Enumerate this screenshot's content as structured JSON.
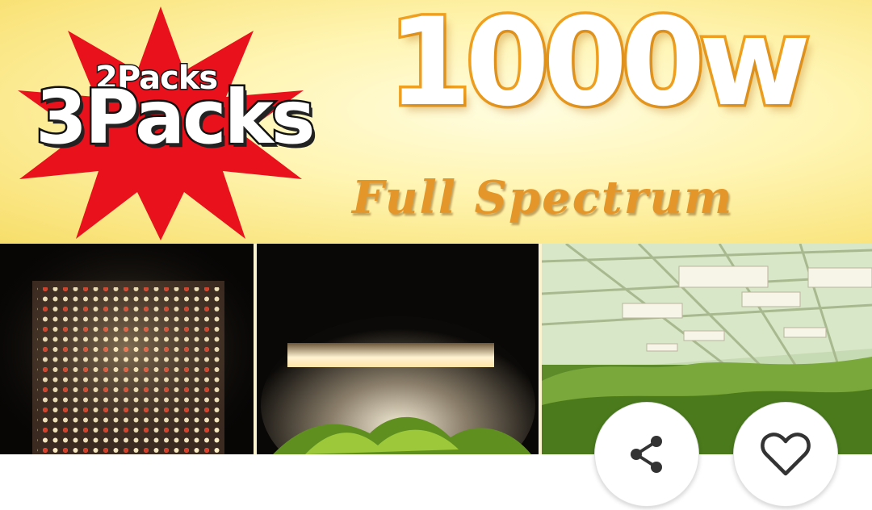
{
  "banner": {
    "packs_small": "2Packs",
    "packs_big": "3Packs",
    "wattage": "1000w",
    "subtitle": "Full Spectrum"
  },
  "actions": {
    "share_icon": "share-icon",
    "favorite_icon": "heart-outline-icon"
  },
  "colors": {
    "starburst": "#e8111c",
    "wattage_outline": "#f0a020",
    "subtitle": "#e4962a",
    "icon": "#333333"
  }
}
